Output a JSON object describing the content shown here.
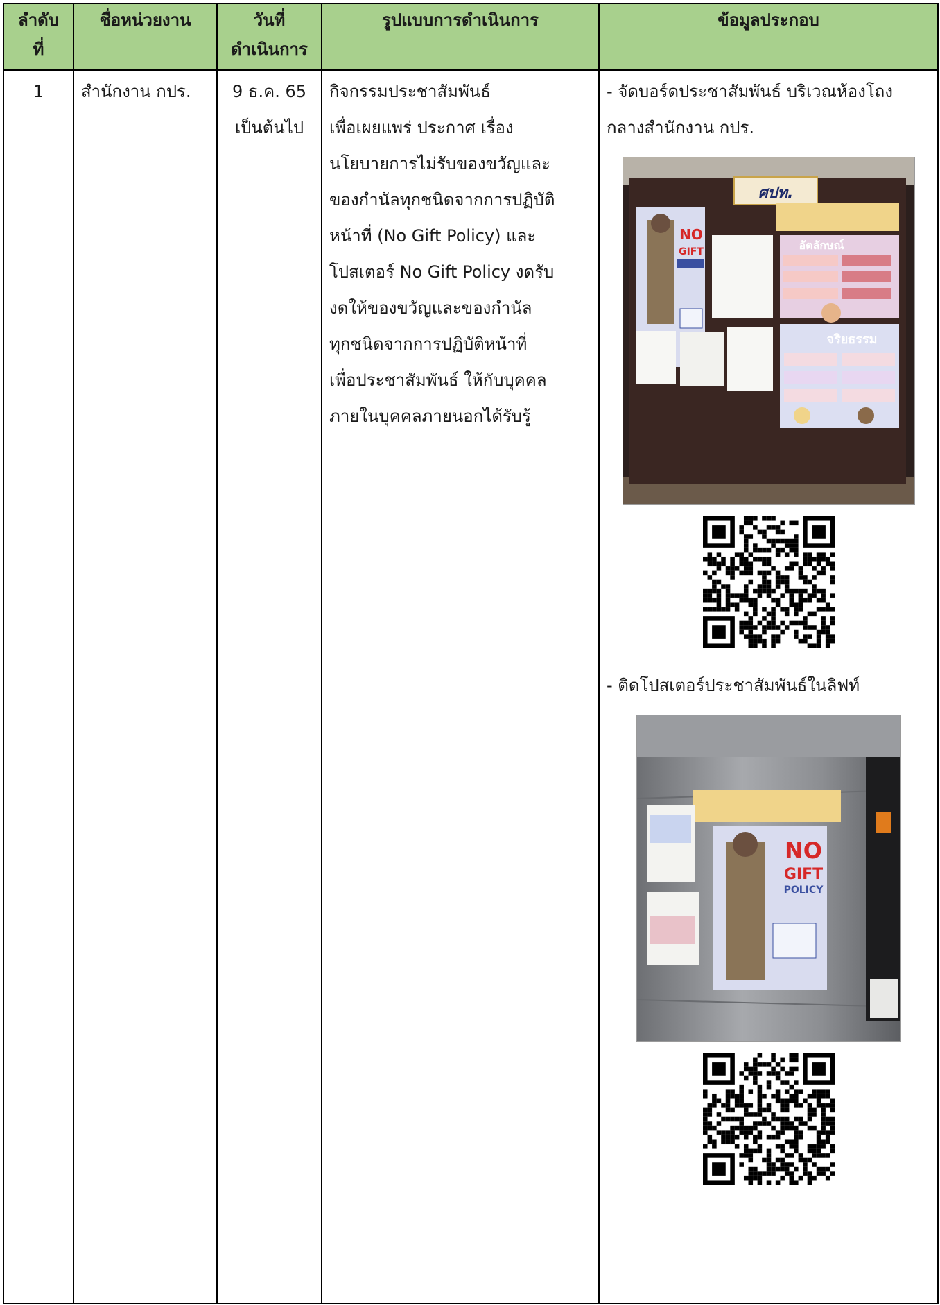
{
  "table": {
    "headers": {
      "no": [
        "ลำดับ",
        "ที่"
      ],
      "agency": "ชื่อหน่วยงาน",
      "date": [
        "วันที่",
        "ดำเนินการ"
      ],
      "method": "รูปแบบการดำเนินการ",
      "info": "ข้อมูลประกอบ"
    },
    "row1": {
      "no": "1",
      "agency": "สำนักงาน กปร.",
      "date": [
        "9 ธ.ค. 65",
        "เป็นต้นไป"
      ],
      "method": [
        "กิจกรรมประชาสัมพันธ์",
        "เพื่อเผยแพร่ ประกาศ เรื่อง",
        "นโยบายการไม่รับของขวัญและ",
        "ของกำนัลทุกชนิดจากการปฏิบัติ",
        "หน้าที่ (No Gift Policy) และ",
        "โปสเตอร์ No Gift Policy งดรับ",
        "งดให้ของขวัญและของกำนัล",
        "ทุกชนิดจากการปฏิบัติหน้าที่",
        "เพื่อประชาสัมพันธ์ ให้กับบุคคล",
        "ภายในบุคคลภายนอกได้รับรู้"
      ],
      "info_1": [
        "- จัดบอร์ดประชาสัมพันธ์ บริเวณห้องโถง",
        "กลางสำนักงาน กปร."
      ],
      "info_2": "- ติดโปสเตอร์ประชาสัมพันธ์ในลิฟท์",
      "board_sign": "ศปท.",
      "poster_no": "NO",
      "poster_gift": "GIFT",
      "poster_policy": "POLICY",
      "board_label_1": "อัตลักษณ์",
      "board_label_2": "จริยธรรม"
    }
  },
  "colors": {
    "header_bg": "#a8d08d",
    "border": "#000000",
    "poster_red": "#d62828",
    "poster_blue": "#3a4fa0"
  }
}
